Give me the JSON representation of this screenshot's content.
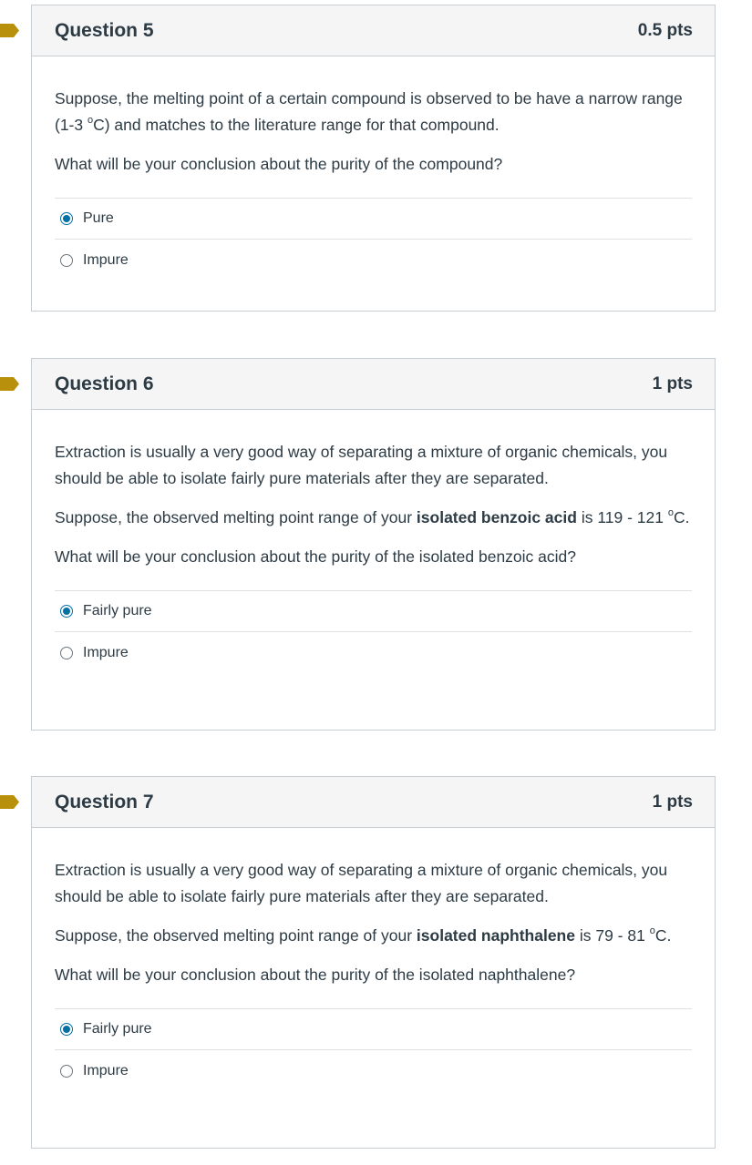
{
  "colors": {
    "flag": "#b8900c",
    "radio_selected": "#0770a3",
    "header_bg": "#f5f5f5",
    "border": "#c7cdd1",
    "text": "#2d3b45"
  },
  "questions": [
    {
      "title": "Question 5",
      "points": "0.5 pts",
      "paragraphs": [
        {
          "pre": "Suppose, the melting point of a certain compound is observed to be have a narrow range (1-3 ",
          "sup": "o",
          "post": "C) and matches to the literature range for that compound."
        },
        {
          "pre": "What will be your conclusion about the purity of the compound?"
        }
      ],
      "answers": [
        {
          "label": "Pure",
          "selected": true
        },
        {
          "label": "Impure",
          "selected": false
        }
      ]
    },
    {
      "title": "Question 6",
      "points": "1 pts",
      "paragraphs": [
        {
          "pre": "Extraction is usually a very good way of separating a mixture of organic chemicals, you should be able to isolate fairly pure materials after they are separated."
        },
        {
          "pre": "Suppose, the observed melting point range of your ",
          "bold": "isolated benzoic acid",
          "mid": " is 119 - 121 ",
          "sup": "o",
          "post": "C."
        },
        {
          "pre": "What will be your conclusion about the purity of the isolated benzoic acid?"
        }
      ],
      "answers": [
        {
          "label": "Fairly pure",
          "selected": true
        },
        {
          "label": "Impure",
          "selected": false
        }
      ]
    },
    {
      "title": "Question 7",
      "points": "1 pts",
      "paragraphs": [
        {
          "pre": "Extraction is usually a very good way of separating a mixture of organic chemicals, you should be able to isolate fairly pure materials after they are separated."
        },
        {
          "pre": "Suppose, the observed melting point range of your ",
          "bold": "isolated naphthalene",
          "mid": " is 79 - 81 ",
          "sup": "o",
          "post": "C."
        },
        {
          "pre": "What will be your conclusion about the purity of the isolated naphthalene?"
        }
      ],
      "answers": [
        {
          "label": "Fairly pure",
          "selected": true
        },
        {
          "label": "Impure",
          "selected": false
        }
      ]
    }
  ]
}
